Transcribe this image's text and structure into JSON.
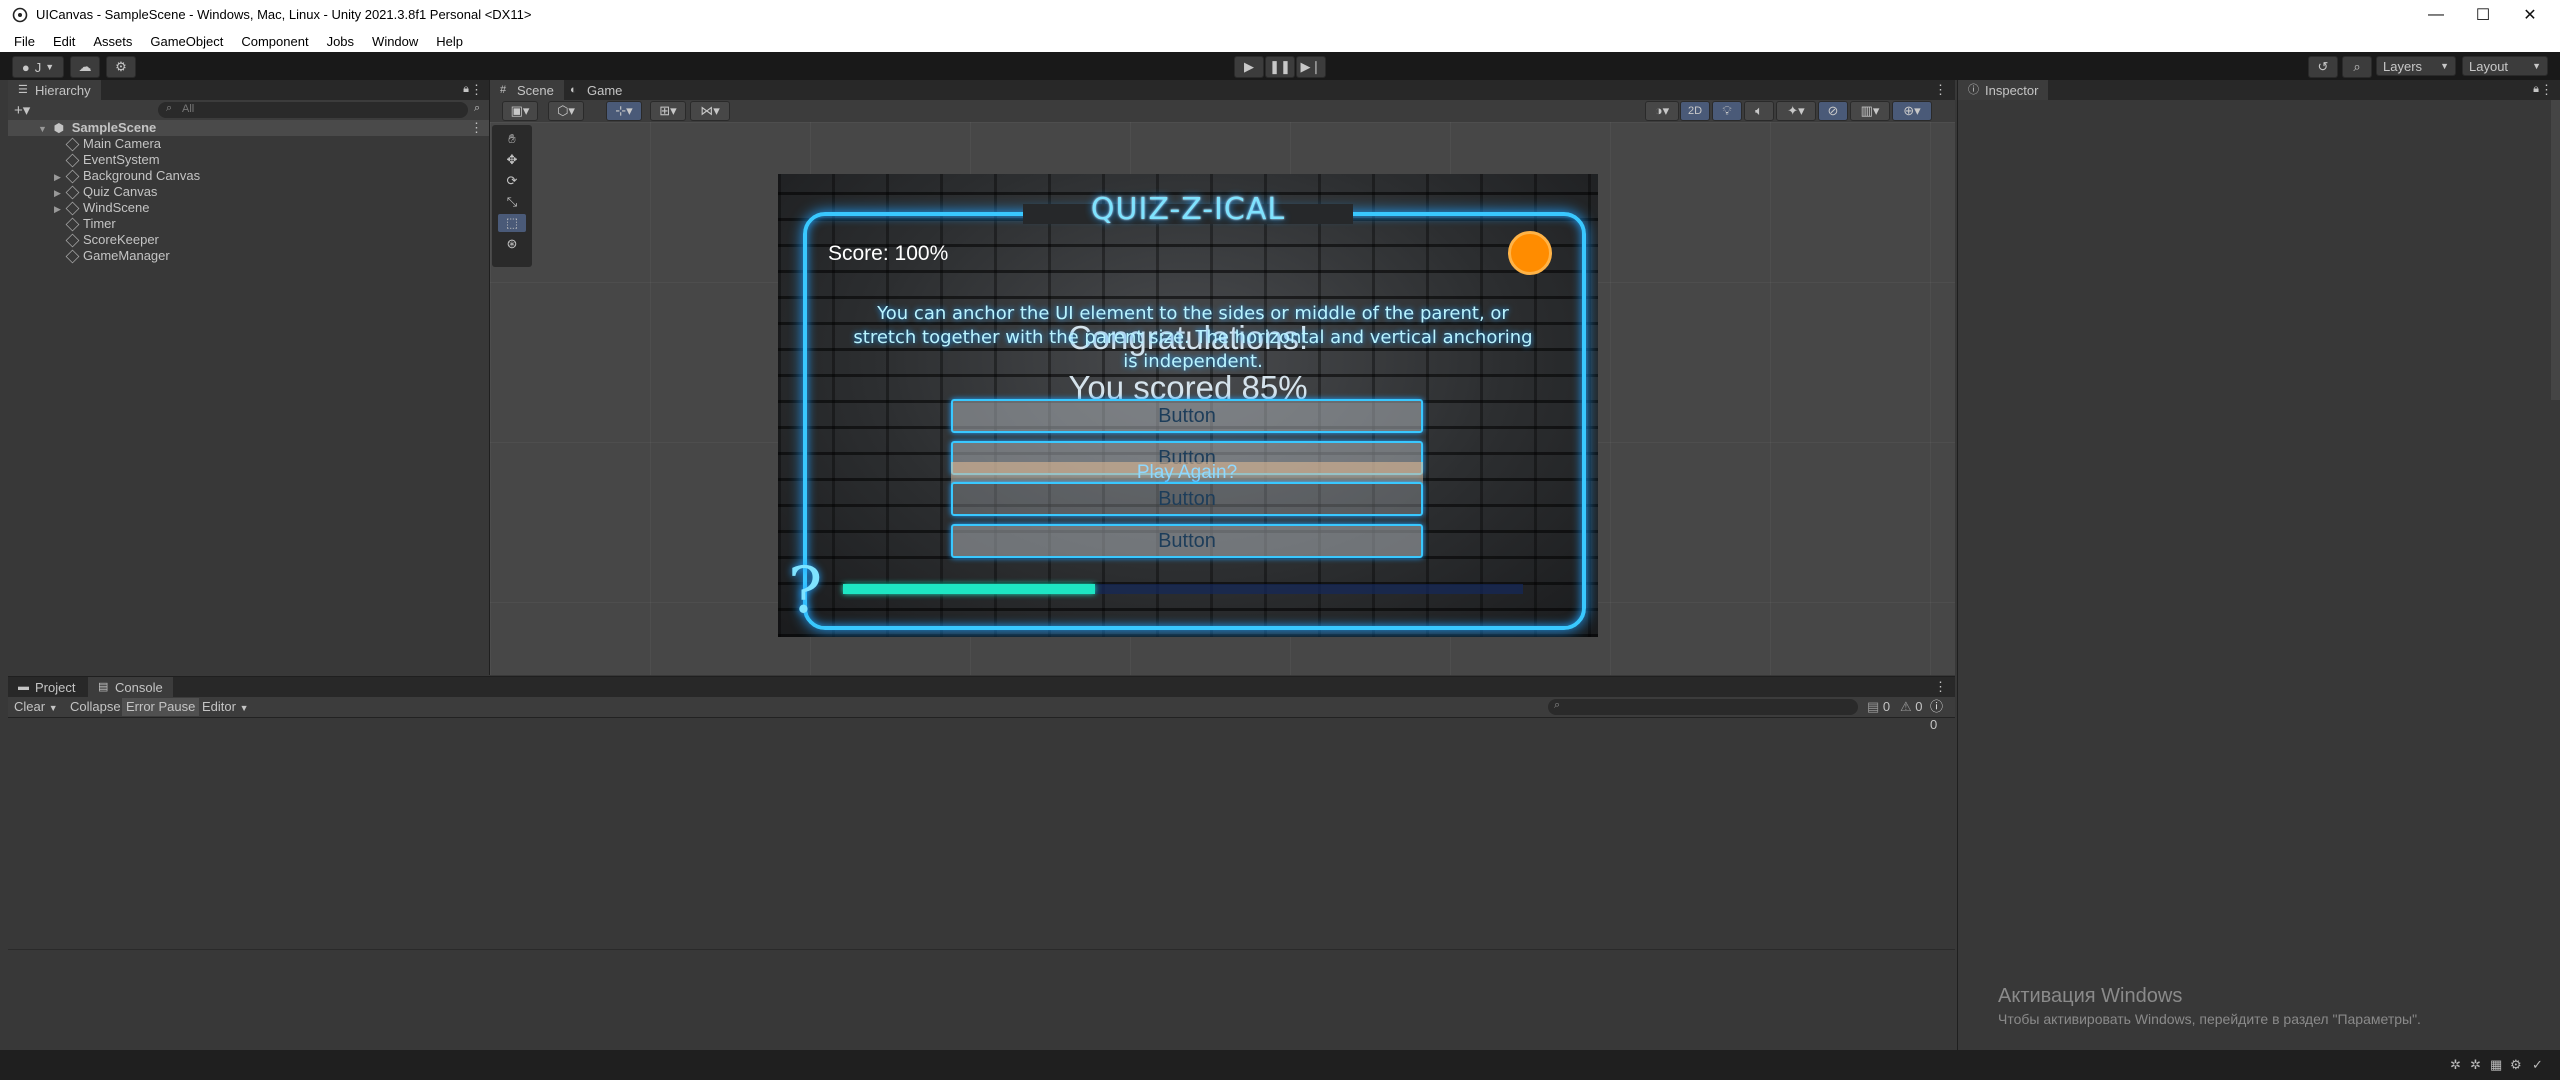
{
  "window": {
    "title": "UICanvas - SampleScene - Windows, Mac, Linux - Unity 2021.3.8f1 Personal <DX11>"
  },
  "menu": [
    "File",
    "Edit",
    "Assets",
    "GameObject",
    "Component",
    "Jobs",
    "Window",
    "Help"
  ],
  "toolbar": {
    "account": "J",
    "layers": "Layers",
    "layout": "Layout"
  },
  "hierarchy": {
    "tab": "Hierarchy",
    "search_placeholder": "All",
    "scene": "SampleScene",
    "items": [
      {
        "label": "Main Camera",
        "expandable": false
      },
      {
        "label": "EventSystem",
        "expandable": false
      },
      {
        "label": "Background Canvas",
        "expandable": true
      },
      {
        "label": "Quiz Canvas",
        "expandable": true
      },
      {
        "label": "WindScene",
        "expandable": true
      },
      {
        "label": "Timer",
        "expandable": false
      },
      {
        "label": "ScoreKeeper",
        "expandable": false
      },
      {
        "label": "GameManager",
        "expandable": false
      }
    ]
  },
  "scene": {
    "tabs": [
      "Scene",
      "Game"
    ],
    "mode_2d": "2D"
  },
  "game_view": {
    "title": "QUIZ-Z-ICAL",
    "score": "Score: 100%",
    "question": "You can anchor the UI element to the sides or middle of the parent, or stretch together with the parent size. The horizontal and vertical anchoring is independent.",
    "congrats": "Congratulations!",
    "scored": "You scored 85%",
    "buttons": [
      "Button",
      "Button",
      "Button",
      "Button"
    ],
    "play_again": "Play Again?",
    "progress": 0.37,
    "question_mark": "?"
  },
  "inspector": {
    "tab": "Inspector"
  },
  "console": {
    "tabs": [
      "Project",
      "Console"
    ],
    "clear": "Clear",
    "collapse": "Collapse",
    "error_pause": "Error Pause",
    "editor": "Editor",
    "counts": [
      "0",
      "0",
      "0"
    ]
  },
  "watermark": {
    "line1": "Активация Windows",
    "line2": "Чтобы активировать Windows, перейдите в раздел \"Параметры\"."
  },
  "colors": {
    "neon": "#39c8ff",
    "progress": "#1ee6c3",
    "timer": "#ff8c00"
  }
}
